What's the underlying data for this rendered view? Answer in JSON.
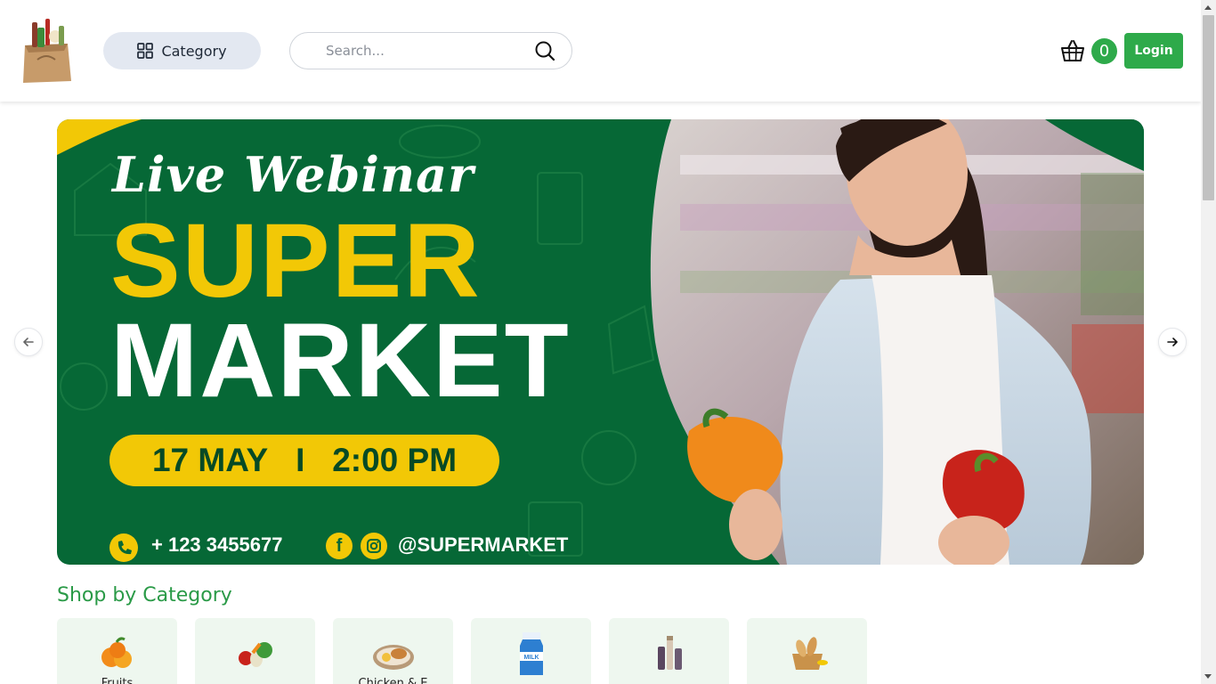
{
  "header": {
    "category_label": "Category",
    "search_placeholder": "Search...",
    "cart_count": "0",
    "login_label": "Login"
  },
  "banner": {
    "live_text": "Live Webinar",
    "title_line1": "SUPER",
    "title_line2": "MARKET",
    "date": "17 MAY",
    "separator": "I",
    "time": "2:00 PM",
    "phone": "+ 123 3455677",
    "handle": "@SUPERMARKET",
    "colors": {
      "background": "#066836",
      "accent": "#f2c806"
    }
  },
  "categories": {
    "title": "Shop by Category",
    "items": [
      {
        "label": "Fruits",
        "icon": "fruits-icon"
      },
      {
        "label": "",
        "icon": "vegetables-icon"
      },
      {
        "label": "Chicken & E",
        "icon": "chicken-egg-icon"
      },
      {
        "label": "",
        "icon": "milk-icon"
      },
      {
        "label": "",
        "icon": "cosmetics-icon"
      },
      {
        "label": "",
        "icon": "bakery-icon"
      }
    ]
  },
  "theme": {
    "primary": "#2eaa4a",
    "category_pill": "#e3e8f1"
  }
}
